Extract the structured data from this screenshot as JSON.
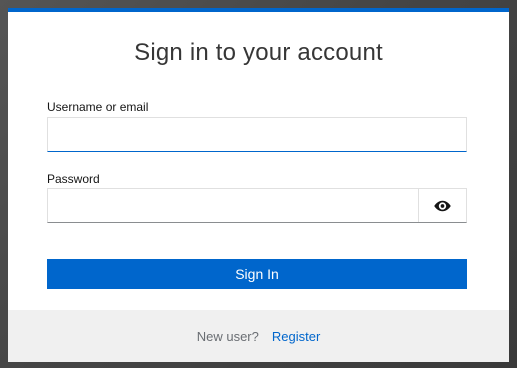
{
  "login": {
    "title": "Sign in to your account",
    "username_label": "Username or email",
    "username_value": "",
    "password_label": "Password",
    "password_value": "",
    "signin_label": "Sign In"
  },
  "footer": {
    "prompt": "New user?",
    "register_label": "Register"
  },
  "icons": {
    "password_toggle": "eye-icon"
  },
  "colors": {
    "accent": "#0066cc",
    "footer_bg": "#f0f0f0",
    "background": "#4a4a4a"
  }
}
